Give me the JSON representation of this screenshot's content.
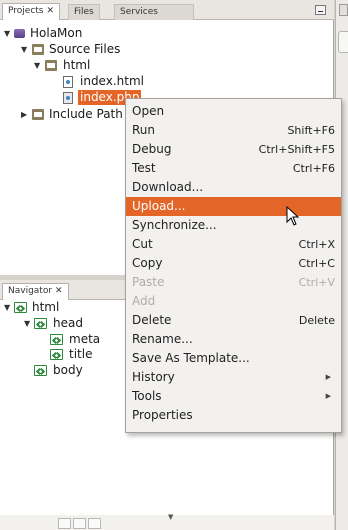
{
  "projects_panel": {
    "tabs": [
      {
        "label": "Projects",
        "close": "✕"
      },
      {
        "label": "Files"
      },
      {
        "label": "Services"
      }
    ],
    "tree": {
      "project": "HolaMon",
      "source_files": "Source Files",
      "html_folder": "html",
      "file1": "index.html",
      "file2": "index.php",
      "include_path": "Include Path"
    }
  },
  "navigator_panel": {
    "tab": {
      "label": "Navigator",
      "close": "✕"
    },
    "tree": {
      "html": "html",
      "head": "head",
      "meta": "meta",
      "title": "title",
      "body": "body"
    }
  },
  "context_menu": {
    "items": [
      {
        "label": "Open",
        "shortcut": ""
      },
      {
        "label": "Run",
        "shortcut": "Shift+F6"
      },
      {
        "label": "Debug",
        "shortcut": "Ctrl+Shift+F5"
      },
      {
        "label": "Test",
        "shortcut": "Ctrl+F6"
      },
      {
        "label": "Download...",
        "shortcut": ""
      },
      {
        "label": "Upload...",
        "shortcut": ""
      },
      {
        "label": "Synchronize...",
        "shortcut": ""
      },
      {
        "label": "Cut",
        "shortcut": "Ctrl+X"
      },
      {
        "label": "Copy",
        "shortcut": "Ctrl+C"
      },
      {
        "label": "Paste",
        "shortcut": "Ctrl+V"
      },
      {
        "label": "Add",
        "shortcut": ""
      },
      {
        "label": "Delete",
        "shortcut": "Delete"
      },
      {
        "label": "Rename...",
        "shortcut": ""
      },
      {
        "label": "Save As Template...",
        "shortcut": ""
      },
      {
        "label": "History",
        "shortcut": ""
      },
      {
        "label": "Tools",
        "shortcut": ""
      },
      {
        "label": "Properties",
        "shortcut": ""
      }
    ],
    "highlight_color": "#e46528"
  },
  "colors": {
    "selection": "#e46528",
    "tag_green": "#2f8a3d"
  }
}
